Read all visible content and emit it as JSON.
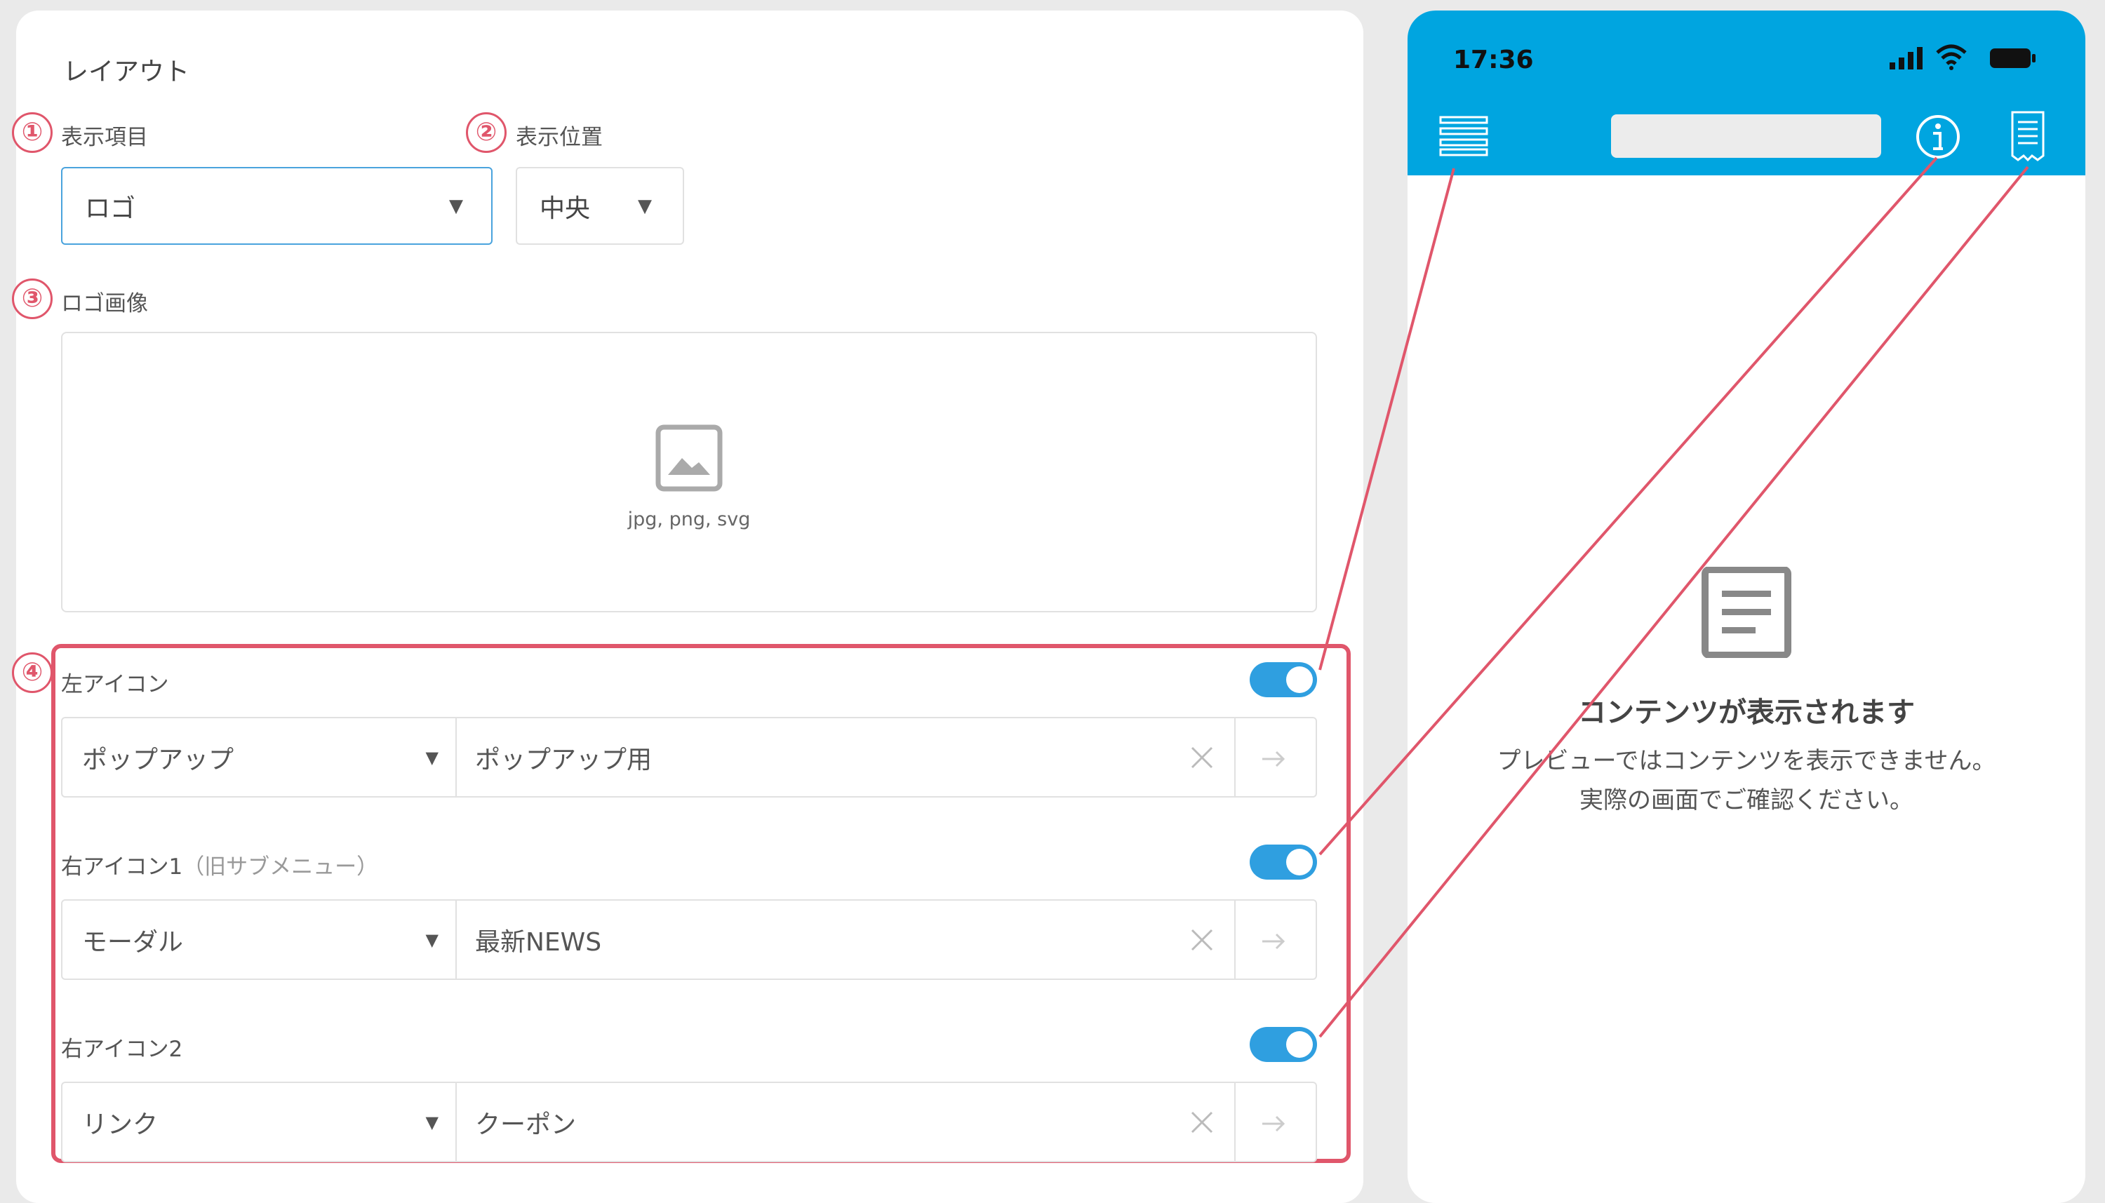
{
  "layout_panel": {
    "title": "レイアウト",
    "display_item": {
      "number": "①",
      "label": "表示項目",
      "value": "ロゴ"
    },
    "display_position": {
      "number": "②",
      "label": "表示位置",
      "value": "中央"
    },
    "logo_image": {
      "number": "③",
      "label": "ロゴ画像",
      "hint": "jpg, png, svg"
    },
    "icons_section_number": "④",
    "left_icon": {
      "label": "左アイコン",
      "enabled": true,
      "type": "ポップアップ",
      "target": "ポップアップ用"
    },
    "right_icon_1": {
      "label": "右アイコン1",
      "note": "（旧サブメニュー）",
      "enabled": true,
      "type": "モーダル",
      "target": "最新NEWS"
    },
    "right_icon_2": {
      "label": "右アイコン2",
      "enabled": true,
      "type": "リンク",
      "target": "クーポン"
    }
  },
  "preview": {
    "status_time": "17:36",
    "header_icons": [
      "menu-icon",
      "info-icon",
      "receipt-icon"
    ],
    "empty_title": "コンテンツが表示されます",
    "empty_line1": "プレビューではコンテンツを表示できません。",
    "empty_line2": "実際の画面でご確認ください。"
  },
  "colors": {
    "accent_blue": "#2f9fe0",
    "header_blue": "#00a5e0",
    "highlight_red": "#e0566b"
  }
}
